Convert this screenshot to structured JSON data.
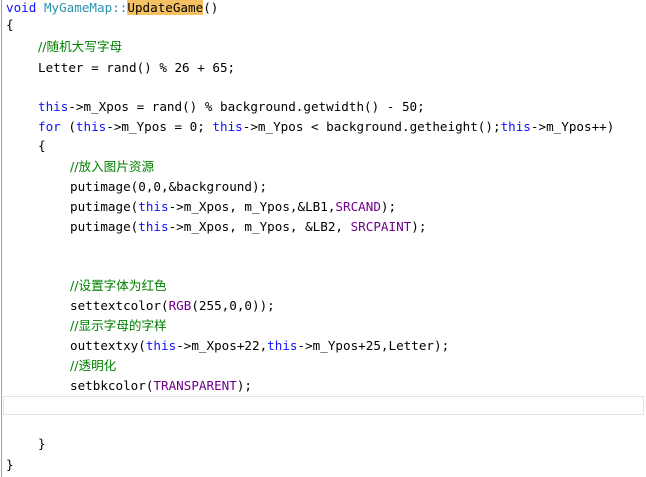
{
  "editor": {
    "lines": {
      "l1": {
        "kw": "void",
        "cls": "MyGameMap",
        "sep": "::",
        "fn": "UpdateGame",
        "rest": "()"
      },
      "l2": {
        "text": "{"
      },
      "l3": {
        "comment": "//随机大写字母"
      },
      "l4": {
        "text": "Letter = rand() % 26 + 65;"
      },
      "l6": {
        "kw": "this",
        "rest": "->m_Xpos = rand() % background.getwidth() - 50;"
      },
      "l7": {
        "kw1": "for",
        "mid1": " (",
        "kw2": "this",
        "mid2": "->m_Ypos = 0; ",
        "kw3": "this",
        "mid3": "->m_Ypos < background.getheight();",
        "kw4": "this",
        "mid4": "->m_Ypos++)"
      },
      "l8": {
        "text": "{"
      },
      "l9": {
        "comment": "//放入图片资源"
      },
      "l10": {
        "text": "putimage(0,0,&background);"
      },
      "l11": {
        "pre": "putimage(",
        "kw": "this",
        "mid": "->m_Xpos, m_Ypos,&LB1,",
        "mac": "SRCAND",
        "post": ");"
      },
      "l12": {
        "pre": "putimage(",
        "kw": "this",
        "mid": "->m_Xpos, m_Ypos, &LB2, ",
        "mac": "SRCPAINT",
        "post": ");"
      },
      "l15": {
        "comment": "//设置字体为红色"
      },
      "l16": {
        "pre": "settextcolor(",
        "mac": "RGB",
        "post": "(255,0,0));"
      },
      "l17": {
        "comment": "//显示字母的字样"
      },
      "l18": {
        "pre": "outtextxy(",
        "kw1": "this",
        "mid": "->m_Xpos+22,",
        "kw2": "this",
        "post": "->m_Ypos+25,Letter);"
      },
      "l19": {
        "comment": "//透明化"
      },
      "l20": {
        "pre": "setbkcolor(",
        "mac": "TRANSPARENT",
        "post": ");"
      },
      "l23": {
        "text": "}"
      },
      "l24": {
        "text": "}"
      }
    },
    "colors": {
      "keyword": "#1010ff",
      "class": "#2b91af",
      "comment": "#008000",
      "macro": "#6f008a",
      "highlight": "#f5c061"
    }
  }
}
